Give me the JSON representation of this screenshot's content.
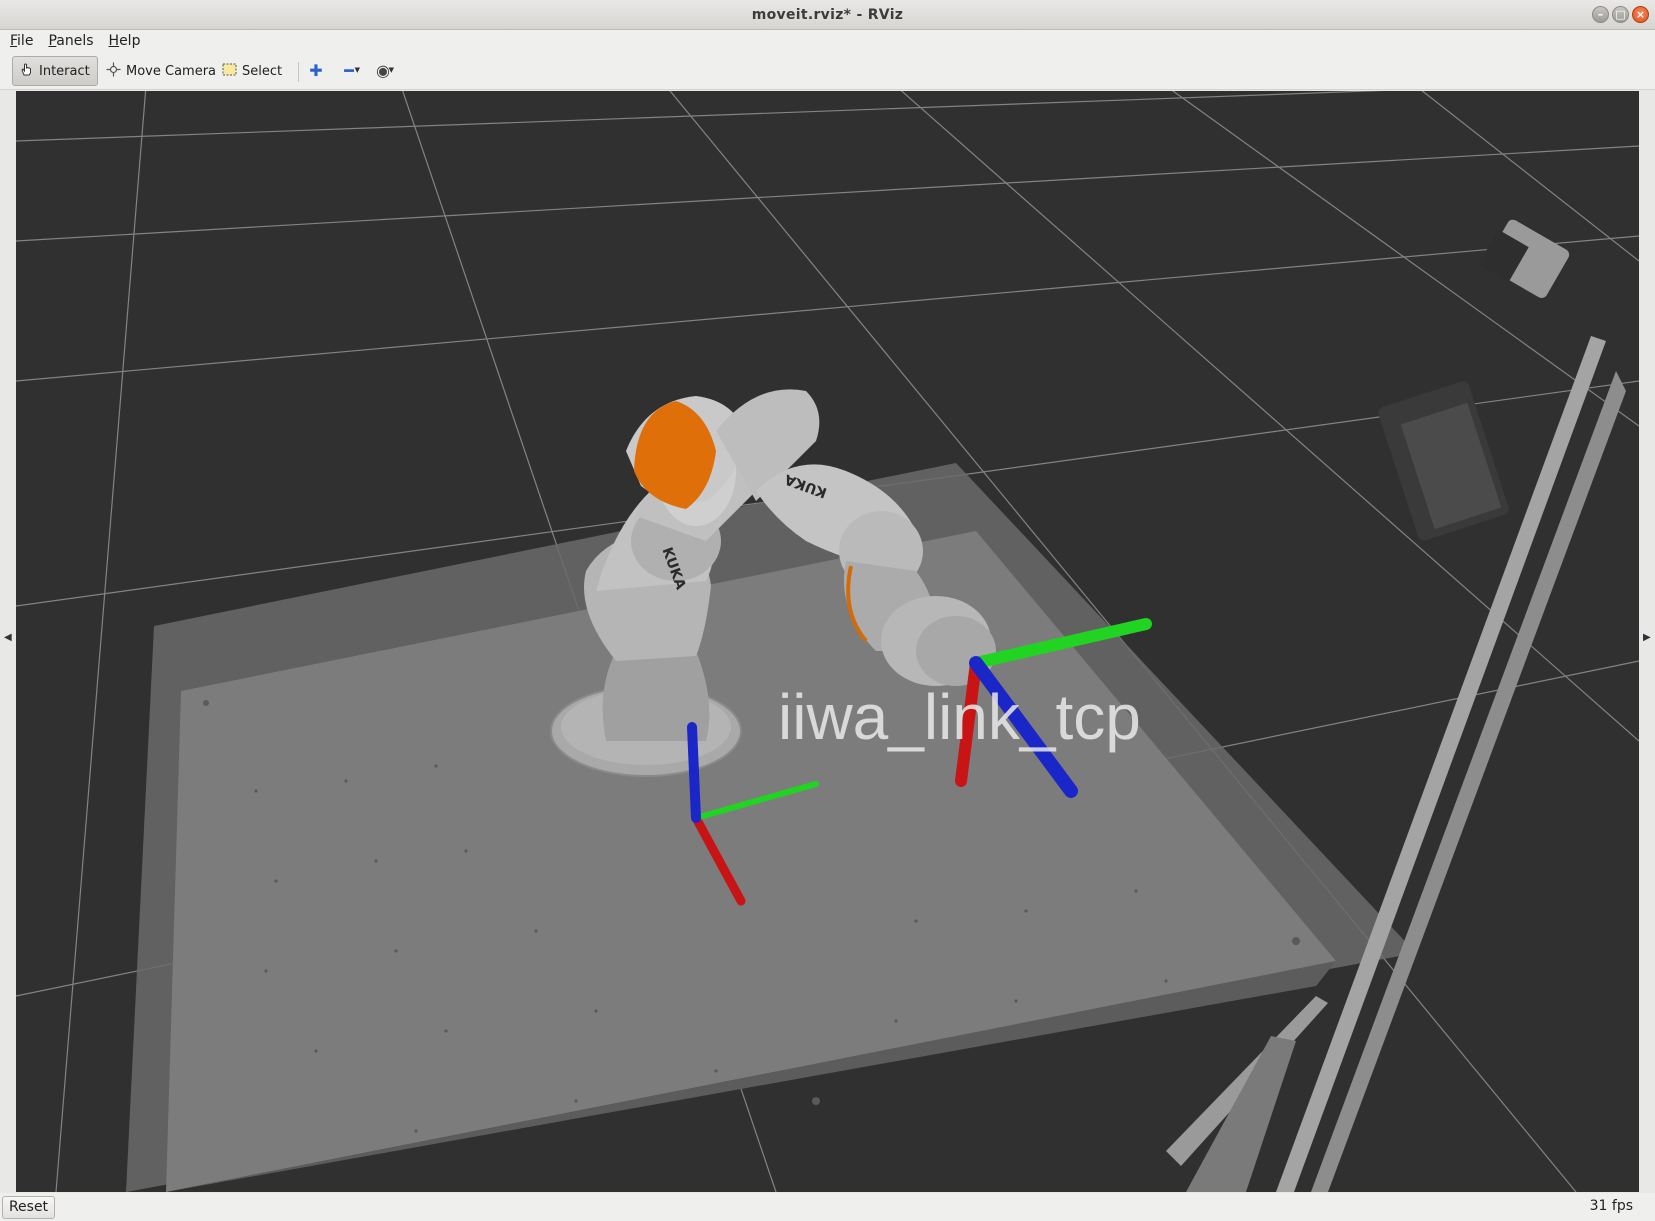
{
  "window": {
    "title": "moveit.rviz* - RViz",
    "controls": {
      "minimize": "–",
      "maximize": "□",
      "close": "×"
    }
  },
  "menu": {
    "file": {
      "accel": "F",
      "rest": "ile"
    },
    "panels": {
      "accel": "P",
      "rest": "anels"
    },
    "help": {
      "accel": "H",
      "rest": "elp"
    }
  },
  "toolbar": {
    "interact": "Interact",
    "move_camera": "Move Camera",
    "select": "Select",
    "icons": [
      "hand-pointer-icon",
      "move-camera-icon",
      "select-rectangle-icon",
      "add-tool-icon",
      "remove-tool-icon",
      "view-eye-icon"
    ]
  },
  "scene": {
    "frame_label": "iiwa_link_tcp",
    "robot_logo": "KUKA",
    "colors": {
      "background": "#303030",
      "grid": "#9a9a9a",
      "table": "#6e6e6e",
      "robot_body": "#b9b9b9",
      "robot_accent": "#e0700a",
      "axis_x": "#c81414",
      "axis_y": "#22d422",
      "axis_z": "#1a26c8"
    }
  },
  "status": {
    "reset": "Reset",
    "fps": "31 fps"
  }
}
